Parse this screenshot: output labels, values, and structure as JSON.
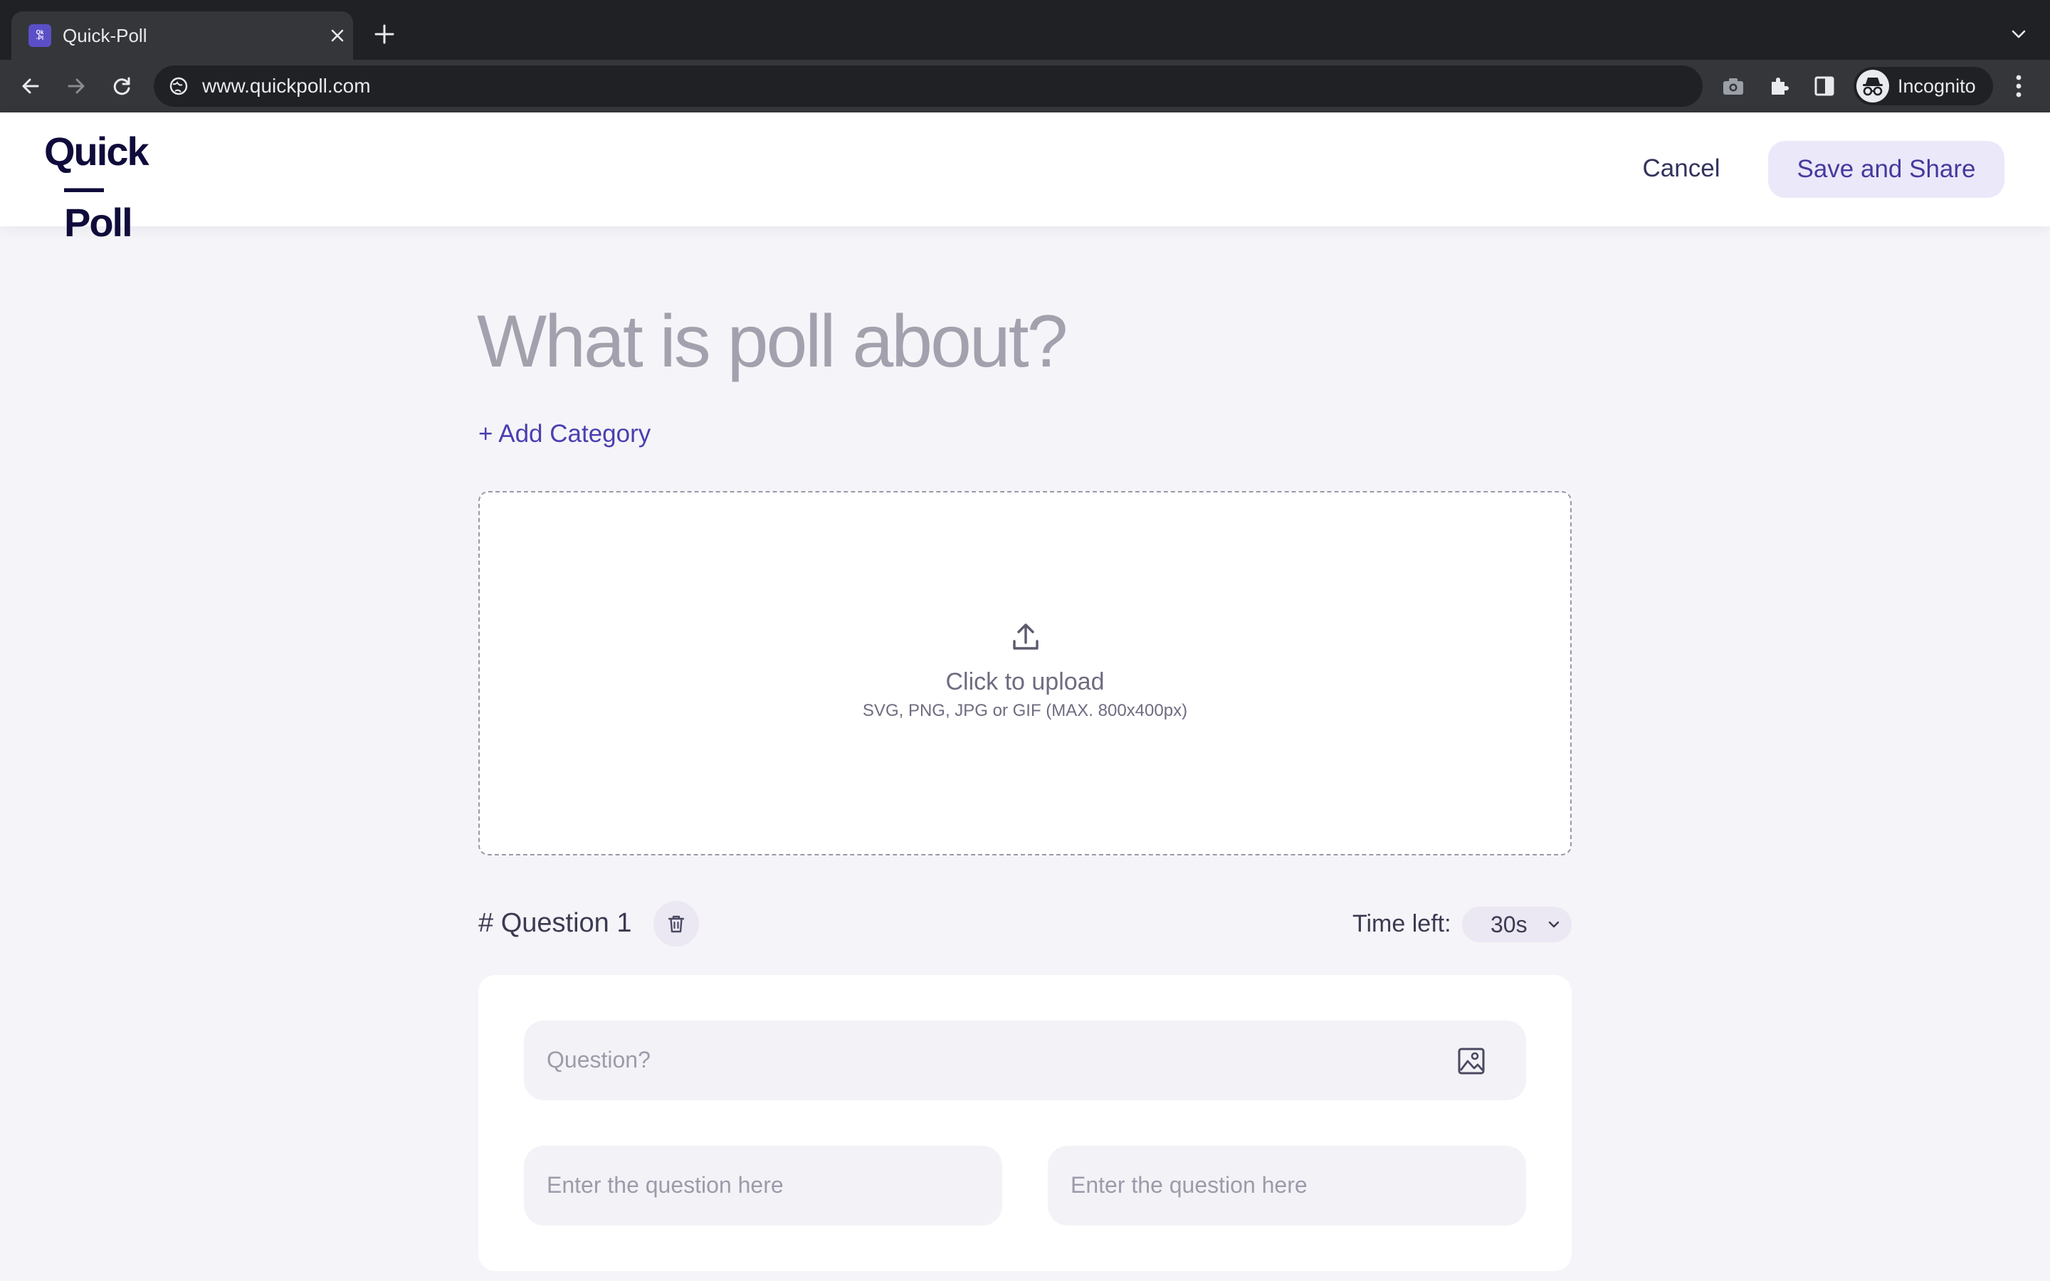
{
  "browser": {
    "tab_title": "Quick-Poll",
    "url": "www.quickpoll.com",
    "profile_label": "Incognito",
    "favicon_text": "Quick\n-Poll",
    "icons": {
      "tab_close": "close-icon",
      "new_tab": "plus-icon",
      "tab_list": "chevron-down-icon",
      "back": "arrow-left-icon",
      "forward": "arrow-right-icon",
      "reload": "reload-icon",
      "site_info": "site-info-icon",
      "screenshot": "camera-icon",
      "extensions": "puzzle-icon",
      "side_panel": "side-panel-icon",
      "profile": "incognito-icon",
      "menu": "kebab-menu-icon"
    }
  },
  "header": {
    "logo_line1": "Quick",
    "logo_line2": "—Poll",
    "cancel_label": "Cancel",
    "save_label": "Save and Share"
  },
  "poll": {
    "title_placeholder": "What is poll about?",
    "add_category_label": "+ Add Category",
    "upload": {
      "title": "Click to upload",
      "hint": "SVG, PNG, JPG or GIF (MAX. 800x400px)",
      "icon": "upload-icon"
    }
  },
  "question": {
    "label": "# Question 1",
    "delete_icon": "trash-icon",
    "time_label": "Time left:",
    "time_value": "30s",
    "question_placeholder": "Question?",
    "image_icon": "image-icon",
    "answers": [
      {
        "placeholder": "Enter the question here"
      },
      {
        "placeholder": "Enter the question here"
      }
    ]
  },
  "colors": {
    "accent": "#453a9e",
    "accent_light": "#ebe8fa",
    "logo": "#0f0c3b",
    "page_bg": "#f5f4f8",
    "chrome_dark": "#202124",
    "chrome_toolbar": "#35363a"
  }
}
